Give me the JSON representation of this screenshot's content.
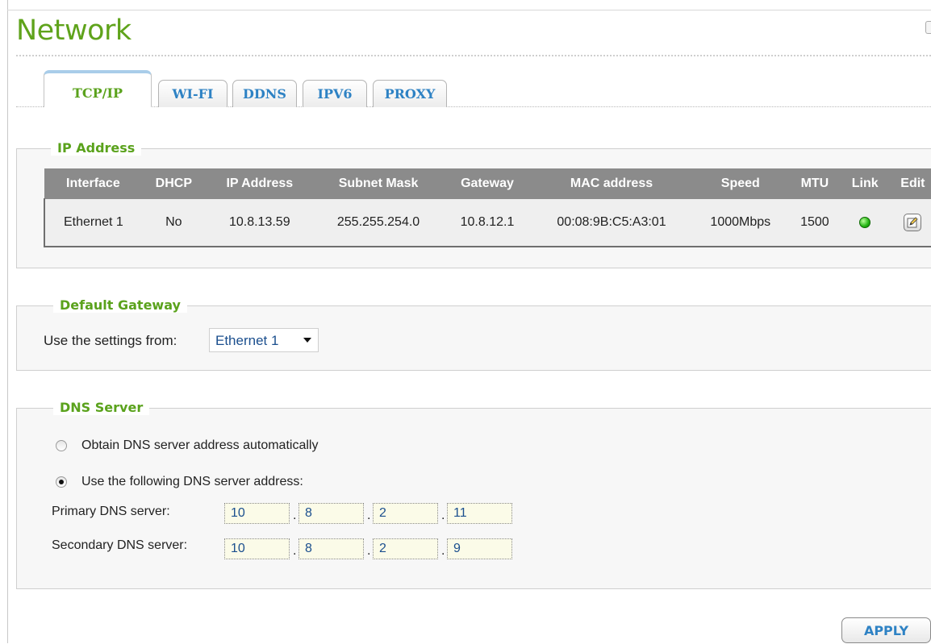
{
  "page": {
    "title": "Network"
  },
  "tabs": [
    {
      "label": "TCP/IP",
      "active": true
    },
    {
      "label": "WI-FI",
      "active": false
    },
    {
      "label": "DDNS",
      "active": false
    },
    {
      "label": "IPV6",
      "active": false
    },
    {
      "label": "PROXY",
      "active": false
    }
  ],
  "ip_section": {
    "legend": "IP Address",
    "columns": [
      "Interface",
      "DHCP",
      "IP Address",
      "Subnet Mask",
      "Gateway",
      "MAC address",
      "Speed",
      "MTU",
      "Link",
      "Edit"
    ],
    "rows": [
      {
        "interface": "Ethernet 1",
        "dhcp": "No",
        "ip": "10.8.13.59",
        "subnet": "255.255.254.0",
        "gateway": "10.8.12.1",
        "mac": "00:08:9B:C5:A3:01",
        "speed": "1000Mbps",
        "mtu": "1500",
        "link_icon": "green-status-dot-icon",
        "edit_icon": "edit-pencil-icon"
      }
    ]
  },
  "gateway_section": {
    "legend": "Default Gateway",
    "label": "Use the settings from:",
    "selected": "Ethernet 1"
  },
  "dns_section": {
    "legend": "DNS Server",
    "option_auto": "Obtain DNS server address automatically",
    "option_manual": "Use the following DNS server address:",
    "selected_option": "manual",
    "primary_label": "Primary DNS server:",
    "primary": [
      "10",
      "8",
      "2",
      "11"
    ],
    "secondary_label": "Secondary DNS server:",
    "secondary": [
      "10",
      "8",
      "2",
      "9"
    ]
  },
  "actions": {
    "apply": "APPLY"
  },
  "colors": {
    "title_green": "#5fa31b",
    "tab_blue": "#2e82c4",
    "legend_green": "#5aa21c",
    "header_gray": "#8b8b8b",
    "link_green": "#22b412"
  }
}
